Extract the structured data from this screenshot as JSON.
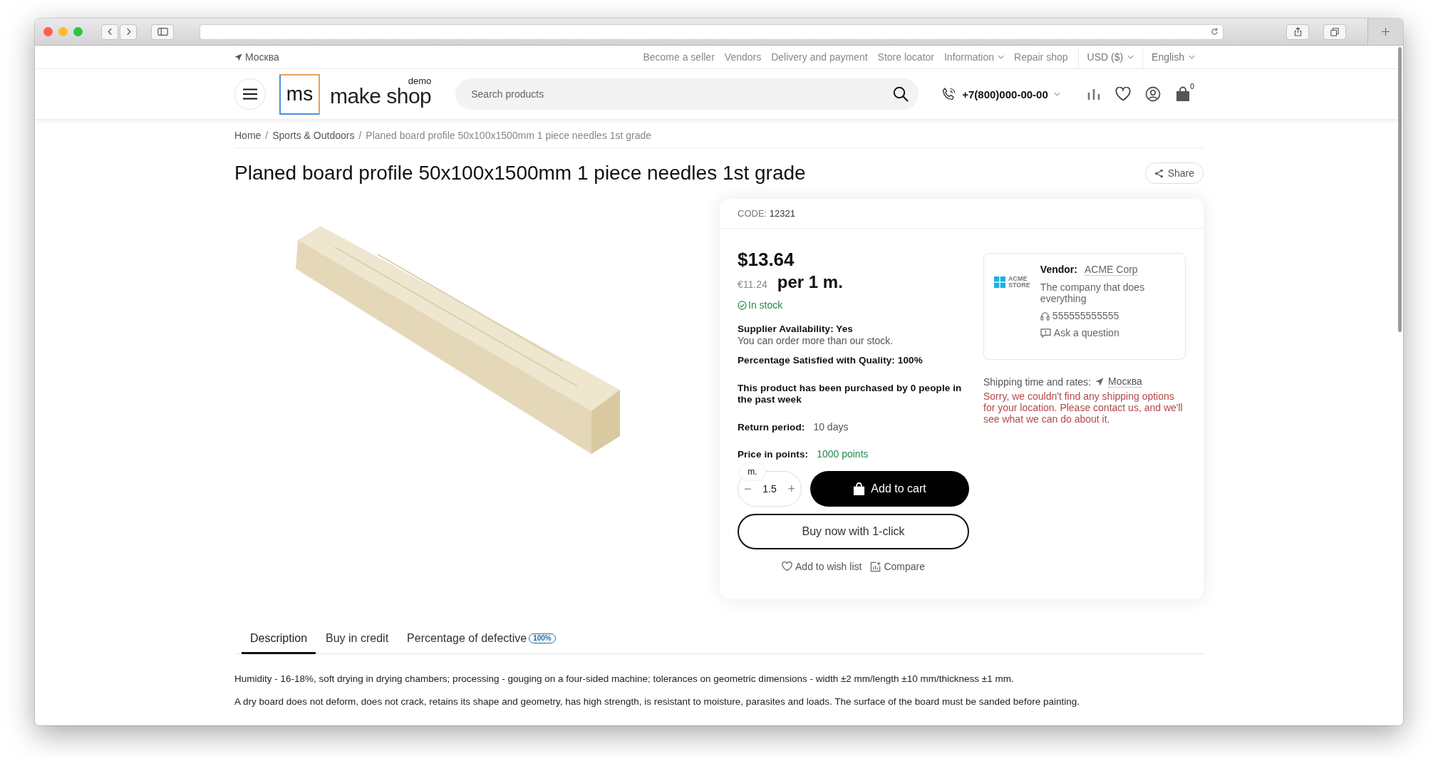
{
  "top_bar": {
    "location": "Москва",
    "links": [
      {
        "label": "Become a seller",
        "dropdown": false
      },
      {
        "label": "Vendors",
        "dropdown": false
      },
      {
        "label": "Delivery and payment",
        "dropdown": false
      },
      {
        "label": "Store locator",
        "dropdown": false
      },
      {
        "label": "Information",
        "dropdown": true
      },
      {
        "label": "Repair shop",
        "dropdown": false
      }
    ],
    "currency": "USD ($)",
    "language": "English"
  },
  "header": {
    "logo_mark": "ms",
    "logo_text": "make shop",
    "logo_badge": "demo",
    "search": {
      "placeholder": "Search products"
    },
    "phone": "+7(800)000-00-00",
    "cart_count": "0"
  },
  "breadcrumbs": {
    "items": [
      {
        "label": "Home",
        "current": false
      },
      {
        "label": "Sports & Outdoors",
        "current": false
      },
      {
        "label": "Planed board profile 50x100x1500mm 1 piece needles 1st grade",
        "current": true
      }
    ],
    "separators": [
      "/",
      "/"
    ]
  },
  "product": {
    "title": "Planed board profile 50x100x1500mm 1 piece needles 1st grade",
    "share": "Share",
    "code_label": "CODE:",
    "code": "12321",
    "price": "$13.64",
    "alt_price": "€11.24",
    "unit": "per 1 m.",
    "stock": "In stock",
    "supplier": {
      "title": "Supplier Availability: Yes",
      "note": "You can order more than our stock."
    },
    "quality": "Percentage Satisfied with Quality: 100%",
    "purchased": "This product has been purchased by 0 people in the past week",
    "return": {
      "label": "Return period:",
      "value": "10 days"
    },
    "points": {
      "label": "Price in points:",
      "value": "1000 points"
    },
    "quantity": {
      "unit": "m.",
      "value": "1.5",
      "minus": "−",
      "plus": "+"
    },
    "add_to_cart": "Add to cart",
    "buy_now": "Buy now with 1-click",
    "wishlist": "Add to wish list",
    "compare": "Compare"
  },
  "vendor": {
    "logo_lines": [
      "ACME",
      "STORE"
    ],
    "label": "Vendor:",
    "name": "ACME Corp",
    "description": "The company that does everything",
    "phone": "555555555555",
    "ask": "Ask a question"
  },
  "shipping": {
    "label": "Shipping time and rates:",
    "location": "Москва",
    "message": "Sorry, we couldn't find any shipping options for your location. Please contact us, and we'll see what we can do about it."
  },
  "tabs": [
    {
      "label": "Description",
      "selected": true
    },
    {
      "label": "Buy in credit",
      "selected": false
    },
    {
      "label": "Percentage of defective",
      "badge": "100%",
      "selected": false
    }
  ],
  "description": [
    "Humidity - 16-18%, soft drying in drying chambers; processing - gouging on a four-sided machine; tolerances on geometric dimensions - width ±2 mm/length ±10 mm/thickness ±1 mm.",
    "A dry board does not deform, does not crack, retains its shape and geometry, has high strength, is resistant to moisture, parasites and loads. The surface of the board must be sanded before painting."
  ]
}
